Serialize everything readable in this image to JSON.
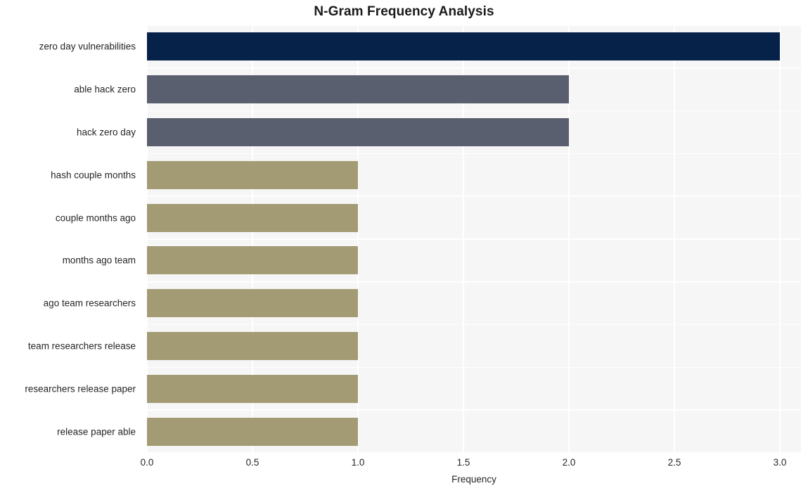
{
  "chart_data": {
    "type": "bar",
    "orientation": "horizontal",
    "title": "N-Gram Frequency Analysis",
    "xlabel": "Frequency",
    "ylabel": "",
    "categories": [
      "zero day vulnerabilities",
      "able hack zero",
      "hack zero day",
      "hash couple months",
      "couple months ago",
      "months ago team",
      "ago team researchers",
      "team researchers release",
      "researchers release paper",
      "release paper able"
    ],
    "values": [
      3,
      2,
      2,
      1,
      1,
      1,
      1,
      1,
      1,
      1
    ],
    "bar_colors": [
      "#062249",
      "#5a5f70",
      "#5a5f70",
      "#a39b74",
      "#a39b74",
      "#a39b74",
      "#a39b74",
      "#a39b74",
      "#a39b74",
      "#a39b74"
    ],
    "xlim": [
      0.0,
      3.1
    ],
    "xticks": [
      0.0,
      0.5,
      1.0,
      1.5,
      2.0,
      2.5,
      3.0
    ],
    "xtick_labels": [
      "0.0",
      "0.5",
      "1.0",
      "1.5",
      "2.0",
      "2.5",
      "3.0"
    ],
    "grid": true,
    "grid_color": "#ffffff",
    "plot_background": "#f6f6f7",
    "figure_background": "#ffffff",
    "legend": null
  }
}
